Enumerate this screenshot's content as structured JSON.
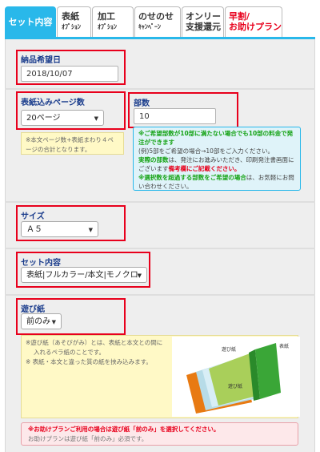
{
  "tabs": [
    {
      "line1": "セット内容",
      "line2": ""
    },
    {
      "line1": "表紙",
      "line2": "ｵﾌﾟｼｮﾝ"
    },
    {
      "line1": "加工",
      "line2": "ｵﾌﾟｼｮﾝ"
    },
    {
      "line1": "のせのせ",
      "line2": "ｷｬﾝﾍﾟｰﾝ"
    },
    {
      "line1": "オンリー",
      "line2": "支援還元"
    },
    {
      "line1": "早割/",
      "line2": "お助けプラン"
    }
  ],
  "delivery": {
    "label": "納品希望日",
    "value": "2018/10/07"
  },
  "pages": {
    "label": "表紙込みページ数",
    "selected": "20ページ",
    "note_line1": "※本文ページ数+表紙まわり４ペ",
    "note_line2": "ージの合計となります。"
  },
  "copies": {
    "label": "部数",
    "value": "10",
    "note": {
      "l1": "※ご希望部数が10部に満たない場合でも10部の料金で発",
      "l2": "注ができます",
      "l3": "(例)5部をご希望の場合→10部をご入力ください。",
      "l4a": "実際の部数",
      "l4b": "は、発注にお進みいただき、印刷発注書画面に",
      "l5a": "ございます",
      "l5b": "備考欄にご記載ください。",
      "l6a": "※選択数を超過する部数をご希望の場合",
      "l6b": "は、お気軽にお問",
      "l7": "い合わせください。"
    }
  },
  "size": {
    "label": "サイズ",
    "selected": "Ａ５"
  },
  "set": {
    "label": "セット内容",
    "selected": "表紙|フルカラー/本文|モノクロ"
  },
  "asobi": {
    "label": "遊び紙",
    "selected": "前のみ",
    "note_line1": "※遊び紙（あそびがみ）とは、表紙と本文との間に",
    "note_line2": "入れるペラ紙のことです。",
    "note_line3": "※ 表紙・本文と違った質の紙を挟み込みます。",
    "illus_label_top": "遊び紙",
    "illus_label_cover": "表紙",
    "illus_label_bottom": "遊び紙"
  },
  "plan_note": {
    "l1": "※お助けプランご利用の場合は遊び紙「前のみ」を選択してください。",
    "l2": "お助けプランは遊び紙「前のみ」必須です。"
  }
}
